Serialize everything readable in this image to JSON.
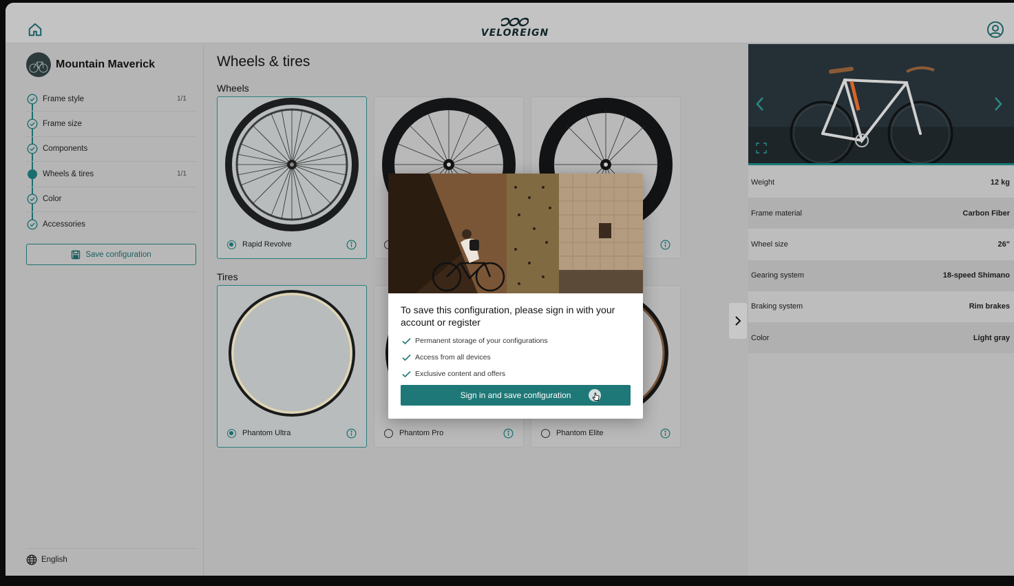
{
  "app": {
    "brand": "VELOREIGN",
    "accent_color": "#1e7877",
    "icons": {
      "home": "home-icon",
      "account": "account-circle-icon",
      "language": "globe-icon"
    }
  },
  "sidebar": {
    "profile_name": "Mountain Maverick",
    "steps": [
      {
        "label": "Frame style",
        "count": "1/1",
        "state": "done"
      },
      {
        "label": "Frame size",
        "count": "",
        "state": "done"
      },
      {
        "label": "Components",
        "count": "",
        "state": "done"
      },
      {
        "label": "Wheels & tires",
        "count": "1/1",
        "state": "current"
      },
      {
        "label": "Color",
        "count": "",
        "state": "done"
      },
      {
        "label": "Accessories",
        "count": "",
        "state": "done"
      }
    ],
    "save_label": "Save configuration",
    "language": "English"
  },
  "main": {
    "title": "Wheels & tires",
    "wheels_title": "Wheels",
    "tires_title": "Tires",
    "wheels": [
      {
        "name": "Rapid Revolve",
        "selected": true
      },
      {
        "name": "",
        "selected": false
      },
      {
        "name": "",
        "selected": false
      }
    ],
    "tires": [
      {
        "name": "Phantom Ultra",
        "selected": true
      },
      {
        "name": "Phantom Pro",
        "selected": false
      },
      {
        "name": "Phantom Elite",
        "selected": false
      }
    ]
  },
  "specs": [
    {
      "label": "Weight",
      "value": "12 kg"
    },
    {
      "label": "Frame material",
      "value": "Carbon Fiber"
    },
    {
      "label": "Wheel size",
      "value": "26\""
    },
    {
      "label": "Gearing system",
      "value": "18-speed Shimano"
    },
    {
      "label": "Braking system",
      "value": "Rim brakes"
    },
    {
      "label": "Color",
      "value": "Light gray"
    }
  ],
  "modal": {
    "title": "To save this configuration, please sign in with your account or register",
    "bullets": [
      "Permanent storage of your configurations",
      "Access from all devices",
      "Exclusive content and offers"
    ],
    "cta": "Sign in and save configuration"
  }
}
